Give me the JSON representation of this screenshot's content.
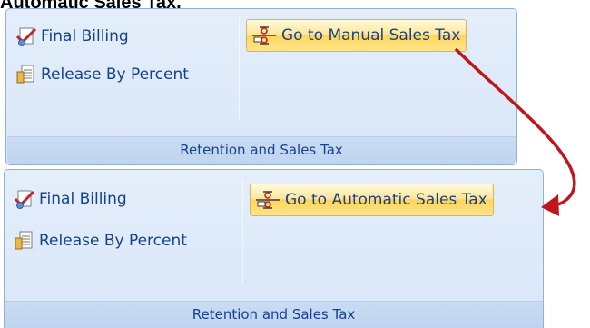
{
  "heading": "Automatic Sales Tax.",
  "top_panel": {
    "final_billing_label": "Final Billing",
    "release_label": "Release By Percent",
    "sales_tax_label": "Go to Manual Sales Tax",
    "group_label": "Retention and Sales Tax"
  },
  "bottom_panel": {
    "final_billing_label": "Final Billing",
    "release_label": "Release By Percent",
    "sales_tax_label": "Go to Automatic Sales Tax",
    "group_label": "Retention and Sales Tax"
  },
  "icons": {
    "final_billing": "billing-check-icon",
    "release": "document-percent-icon",
    "sales_tax": "tax-toggle-icon"
  },
  "colors": {
    "ribbon_text": "#15428b",
    "arrow": "#c0161b",
    "highlight": "#ffd65c"
  }
}
